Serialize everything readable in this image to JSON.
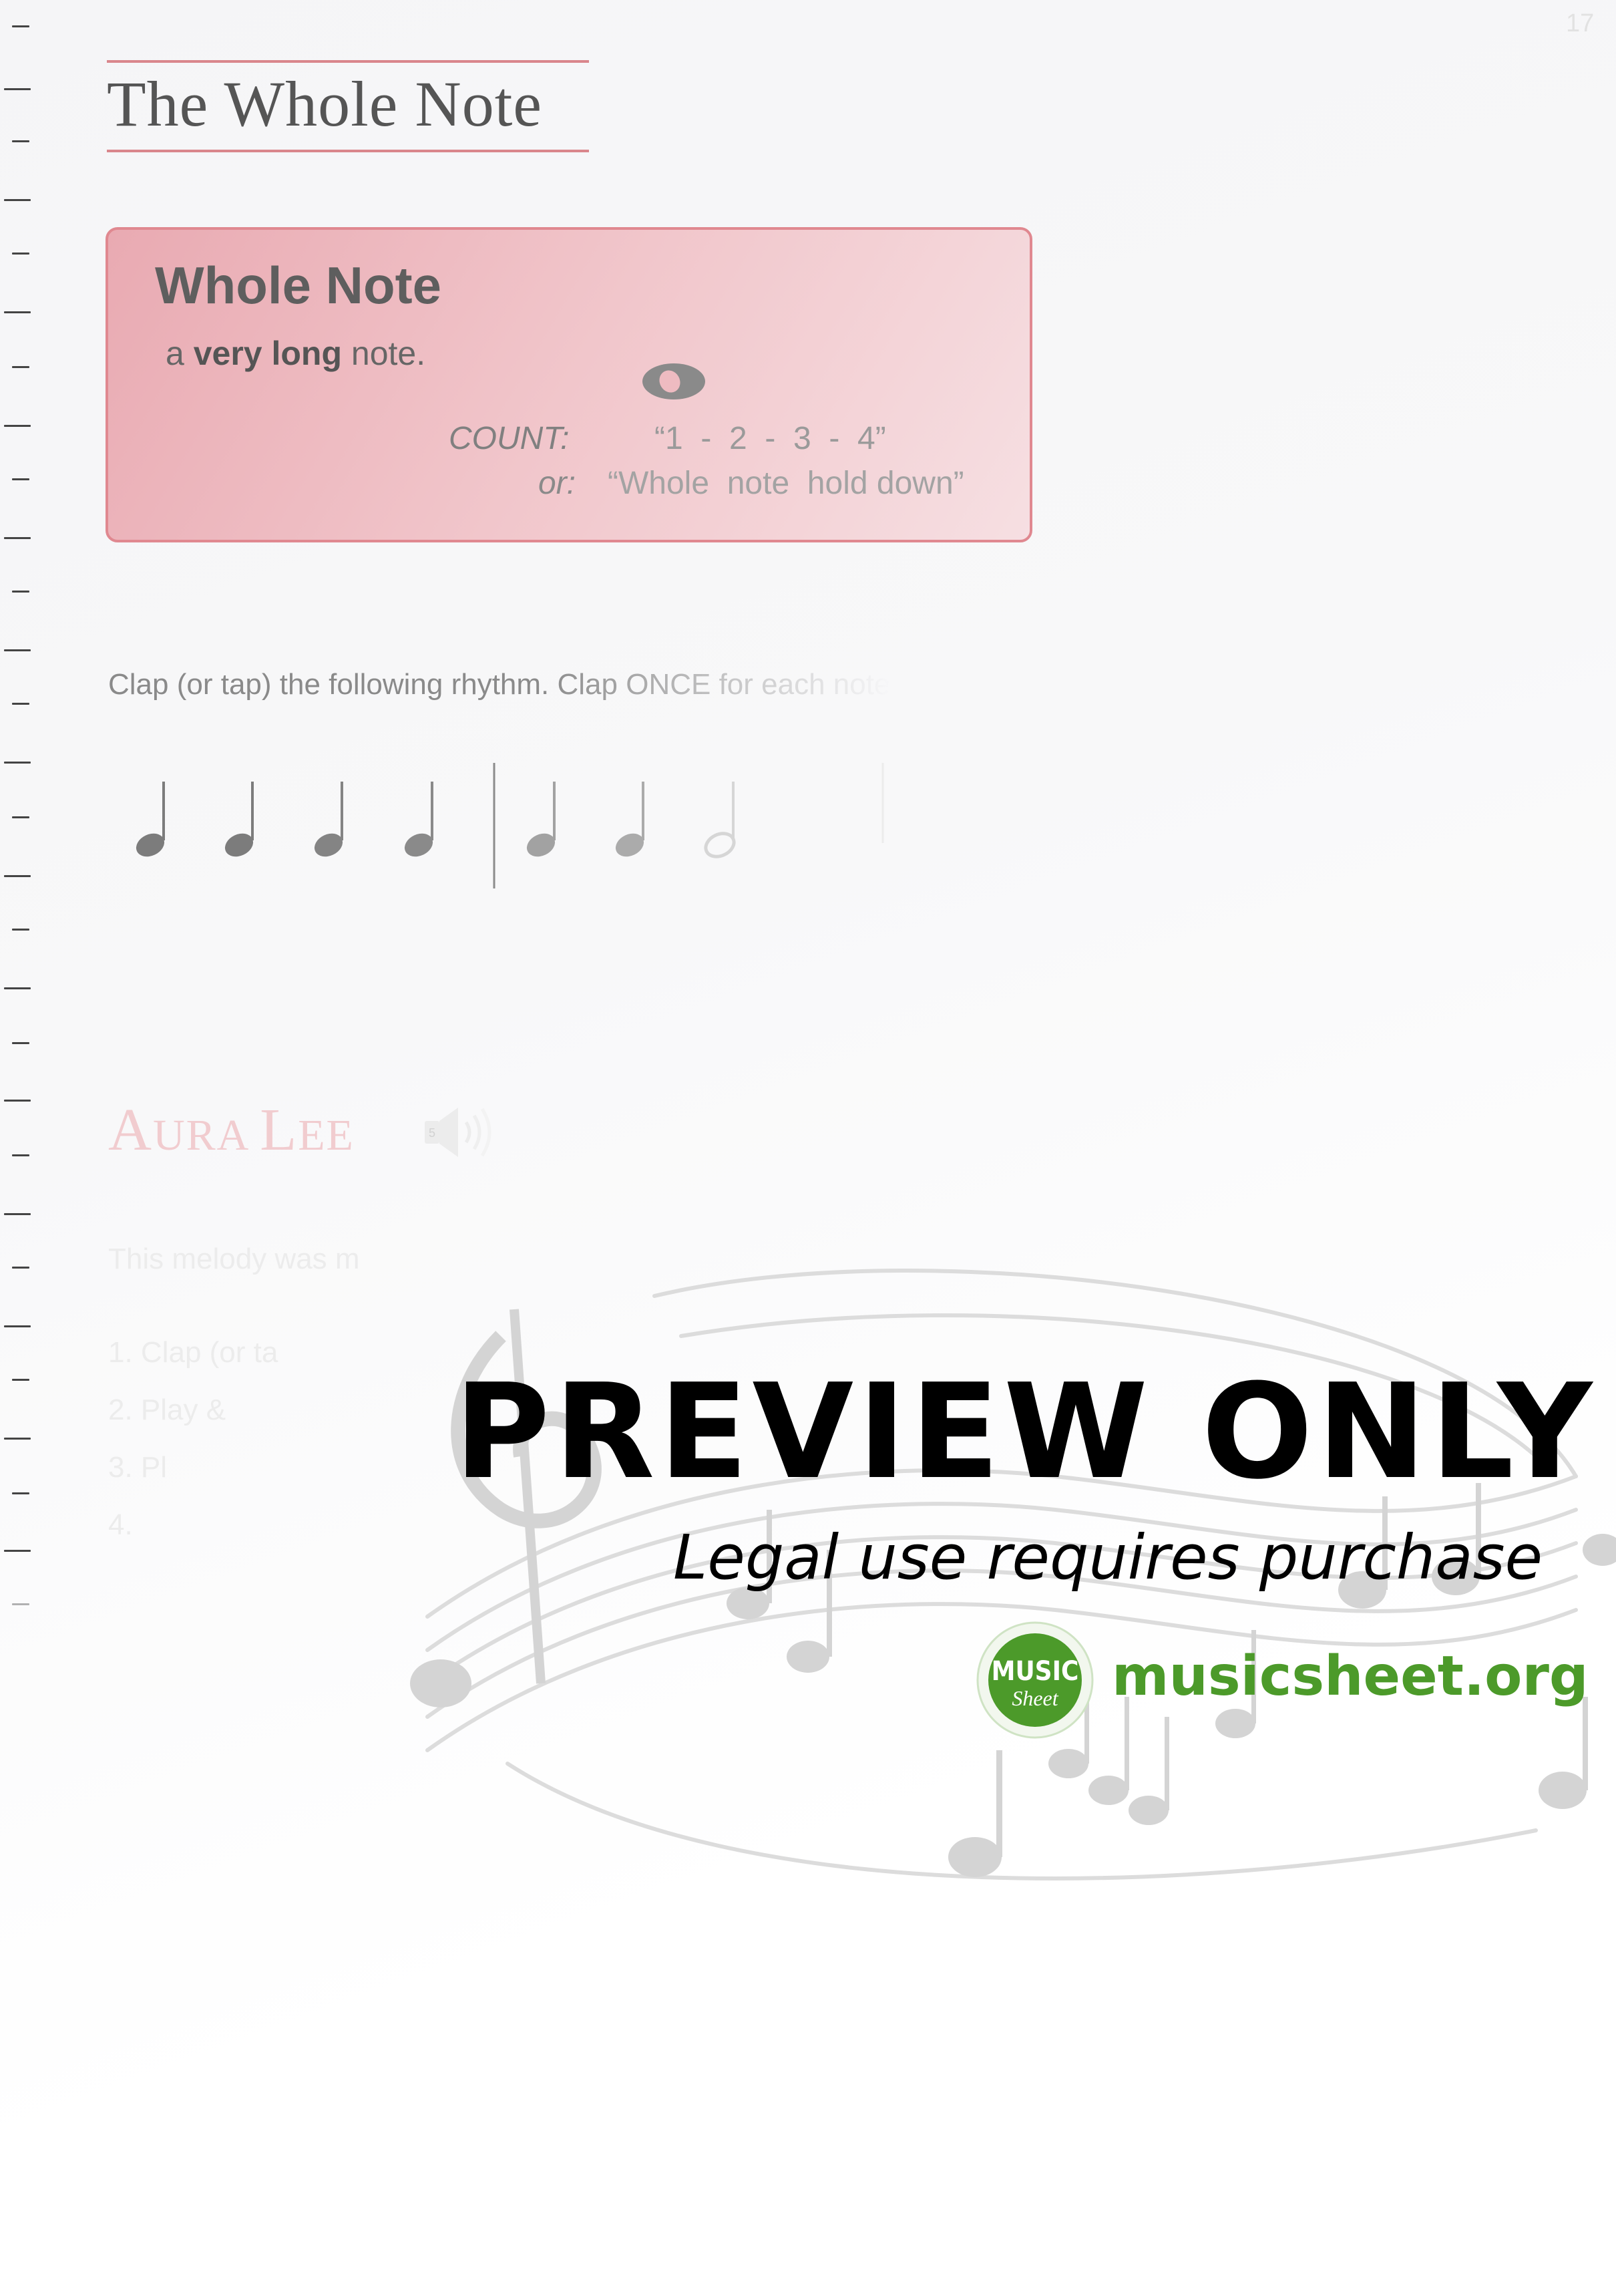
{
  "page_number": "17",
  "title": "The Whole Note",
  "definition": {
    "heading": "Whole Note",
    "desc_prefix": "a ",
    "desc_bold": "very long",
    "desc_suffix": " note.",
    "count_label": "COUNT:",
    "count_value": "“1  -  2  -  3  -  4”",
    "or_label": "or:",
    "or_value": "“Whole  note  hold down”"
  },
  "instruction": {
    "part1": "Clap (or tap) the following rhythm.  Clap ONCE for each note"
  },
  "rhythm": {
    "notes": [
      "quarter",
      "quarter",
      "quarter",
      "quarter",
      "quarter",
      "quarter",
      "half"
    ]
  },
  "song": {
    "title_cap1": "A",
    "title_rest1": "URA ",
    "title_cap2": "L",
    "title_rest2": "EE",
    "intro": "This melody was m",
    "steps": [
      "1.  Clap (or ta",
      "2.  Play & ",
      "3.  Pl",
      "4."
    ]
  },
  "watermark": {
    "headline": "PREVIEW ONLY",
    "subline": "Legal use requires purchase",
    "logo_top": "MUSIC",
    "logo_bottom": "Sheet",
    "site": "musicsheet.org",
    "brand_color": "#4c9a2a"
  }
}
